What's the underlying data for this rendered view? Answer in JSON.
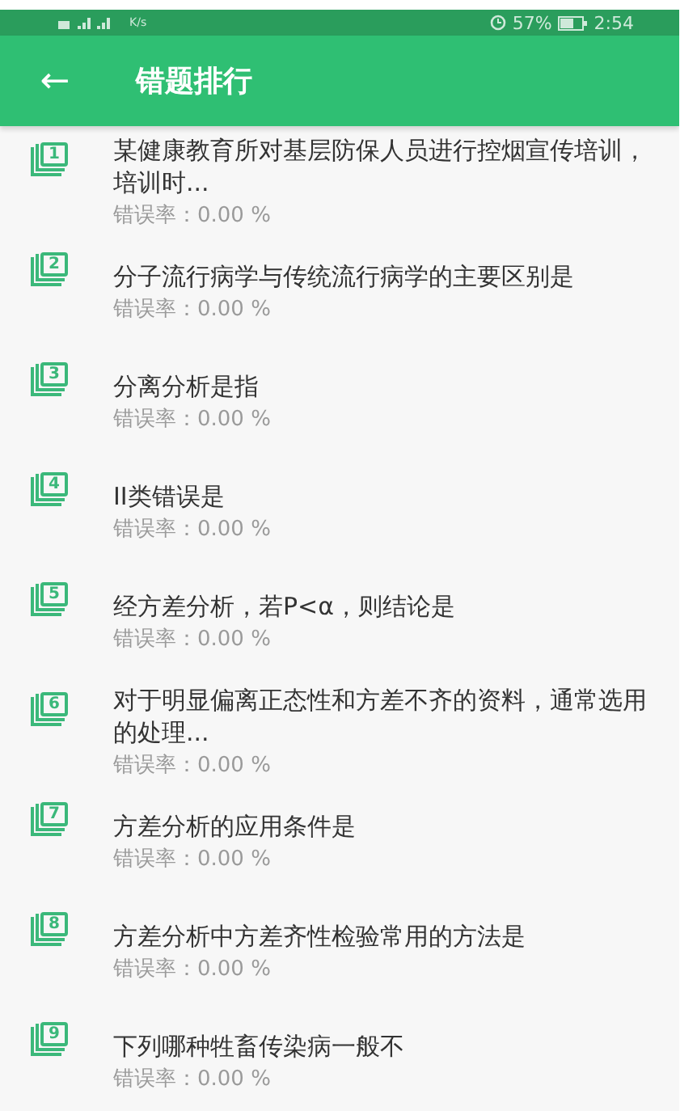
{
  "status_bar": {
    "network_speed": "K/s",
    "battery": "57%",
    "time": "2:54"
  },
  "header": {
    "back": "←",
    "title": "错题排行"
  },
  "questions": [
    {
      "num": "1",
      "title": "某健康教育所对基层防保人员进行控烟宣传培训，培训时...",
      "rate": "错误率：0.00 %"
    },
    {
      "num": "2",
      "title": "分子流行病学与传统流行病学的主要区别是",
      "rate": "错误率：0.00 %"
    },
    {
      "num": "3",
      "title": "分离分析是指",
      "rate": "错误率：0.00 %"
    },
    {
      "num": "4",
      "title": "II类错误是",
      "rate": "错误率：0.00 %"
    },
    {
      "num": "5",
      "title": "经方差分析，若P<α，则结论是",
      "rate": "错误率：0.00 %"
    },
    {
      "num": "6",
      "title": "对于明显偏离正态性和方差不齐的资料，通常选用的处理...",
      "rate": "错误率：0.00 %"
    },
    {
      "num": "7",
      "title": "方差分析的应用条件是",
      "rate": "错误率：0.00 %"
    },
    {
      "num": "8",
      "title": "方差分析中方差齐性检验常用的方法是",
      "rate": "错误率：0.00 %"
    },
    {
      "num": "9",
      "title": "下列哪种牲畜传染病一般不",
      "rate": "错误率：0.00 %"
    }
  ]
}
